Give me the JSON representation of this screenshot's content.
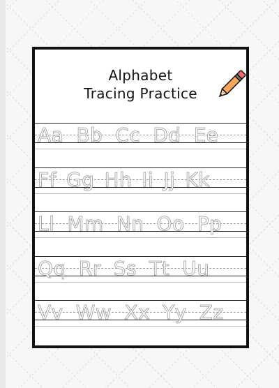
{
  "worksheet": {
    "title_line1": "Alphabet",
    "title_line2": "Tracing Practice",
    "rows": [
      [
        "Aa",
        "Bb",
        "Cc",
        "Dd",
        "Ee"
      ],
      [
        "Ff",
        "Gg",
        "Hh",
        "Ii",
        "Jj",
        "Kk"
      ],
      [
        "Ll",
        "Mm",
        "Nn",
        "Oo",
        "Pp"
      ],
      [
        "Qq",
        "Rr",
        "Ss",
        "Tt",
        "Uu"
      ],
      [
        "Vv",
        "Ww",
        "Xx",
        "Yy",
        "Zz"
      ]
    ]
  },
  "icons": {
    "decoration": "pencil-icon"
  },
  "colors": {
    "pencil_body": "#f7a55b",
    "pencil_tip": "#3a2a1a",
    "eraser": "#f26b6b"
  }
}
